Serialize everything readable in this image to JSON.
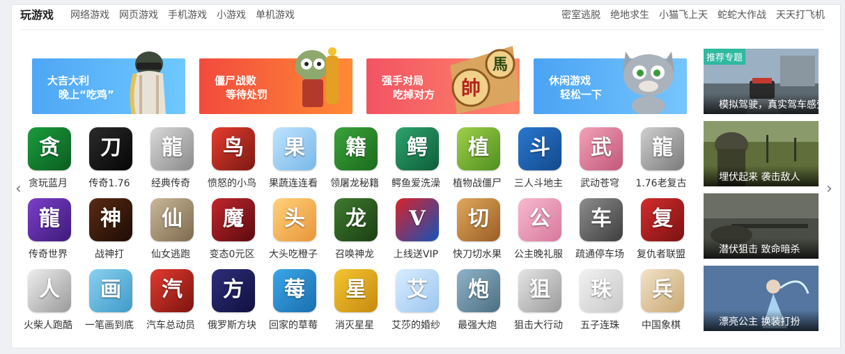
{
  "header": {
    "brand": "玩游戏",
    "nav_left": [
      "网络游戏",
      "网页游戏",
      "手机游戏",
      "小游戏",
      "单机游戏"
    ],
    "nav_right": [
      "密室逃脱",
      "绝地求生",
      "小猫飞上天",
      "蛇蛇大作战",
      "天天打飞机"
    ]
  },
  "banners": [
    {
      "line1": "大吉大利",
      "line2": "晚上“吃鸡”",
      "from": "#4fa6f5",
      "to": "#6ec9ff"
    },
    {
      "line1": "僵尸战败",
      "line2": "等待处罚",
      "from": "#f24a3e",
      "to": "#ff8a34"
    },
    {
      "line1": "强手对局",
      "line2": "吃掉对方",
      "from": "#f25363",
      "to": "#ff866a"
    },
    {
      "line1": "休闲游戏",
      "line2": "轻松一下",
      "from": "#4aa3f3",
      "to": "#75c5ff"
    }
  ],
  "games": [
    [
      {
        "name": "贪玩蓝月",
        "glyph": "贪",
        "c1": "#1a9b3c",
        "c2": "#0b5e20"
      },
      {
        "name": "传奇1.76",
        "glyph": "刀",
        "c1": "#2b2b2b",
        "c2": "#050505"
      },
      {
        "name": "经典传奇",
        "glyph": "龍",
        "c1": "#d9d9d9",
        "c2": "#8a8a8a"
      },
      {
        "name": "愤怒的小鸟",
        "glyph": "鸟",
        "c1": "#e63b2e",
        "c2": "#7a1a12"
      },
      {
        "name": "果蔬连连看",
        "glyph": "果",
        "c1": "#bfe3ff",
        "c2": "#79b8e8"
      },
      {
        "name": "领屠龙秘籍",
        "glyph": "籍",
        "c1": "#3aa33a",
        "c2": "#1c6b1c"
      },
      {
        "name": "鳄鱼爱洗澡",
        "glyph": "鳄",
        "c1": "#2fa36d",
        "c2": "#0d5e3a"
      },
      {
        "name": "植物战僵尸",
        "glyph": "植",
        "c1": "#9fd04a",
        "c2": "#4f8f1f"
      },
      {
        "name": "三人斗地主",
        "glyph": "斗",
        "c1": "#2a77d0",
        "c2": "#134a8c"
      },
      {
        "name": "武动苍穹",
        "glyph": "武",
        "c1": "#f1a2b7",
        "c2": "#c2577a"
      },
      {
        "name": "1.76老复古",
        "glyph": "龍",
        "c1": "#cfcfcf",
        "c2": "#7a7a7a"
      }
    ],
    [
      {
        "name": "传奇世界",
        "glyph": "龍",
        "c1": "#7b3fc9",
        "c2": "#3e1a7a"
      },
      {
        "name": "战神打",
        "glyph": "神",
        "c1": "#5a2a14",
        "c2": "#1e0c05"
      },
      {
        "name": "仙女逃跑",
        "glyph": "仙",
        "c1": "#c9b89a",
        "c2": "#7e6a4e"
      },
      {
        "name": "变态0元区",
        "glyph": "魔",
        "c1": "#c1272d",
        "c2": "#5b0a0e"
      },
      {
        "name": "大头吃橙子",
        "glyph": "头",
        "c1": "#ffd27a",
        "c2": "#e8953a"
      },
      {
        "name": "召唤神龙",
        "glyph": "龙",
        "c1": "#3f7a2f",
        "c2": "#1a3f12"
      },
      {
        "name": "上线送VIP",
        "glyph": "V",
        "c1": "#d8232a",
        "c2": "#1552b8"
      },
      {
        "name": "快刀切水果",
        "glyph": "切",
        "c1": "#e0a85c",
        "c2": "#9a5e25"
      },
      {
        "name": "公主晚礼服",
        "glyph": "公",
        "c1": "#f7b9cf",
        "c2": "#d8789c"
      },
      {
        "name": "疏通停车场",
        "glyph": "车",
        "c1": "#8d8d8d",
        "c2": "#3e3e3e"
      },
      {
        "name": "复仇者联盟",
        "glyph": "复",
        "c1": "#d22c2c",
        "c2": "#7d1212"
      }
    ],
    [
      {
        "name": "火柴人跑酷",
        "glyph": "人",
        "c1": "#eeeeee",
        "c2": "#9a9a9a"
      },
      {
        "name": "一笔画到底",
        "glyph": "画",
        "c1": "#8ad0f0",
        "c2": "#3f9bc8"
      },
      {
        "name": "汽车总动员",
        "glyph": "汽",
        "c1": "#e23a2f",
        "c2": "#7c1510"
      },
      {
        "name": "俄罗斯方块",
        "glyph": "方",
        "c1": "#2e2e7a",
        "c2": "#101040"
      },
      {
        "name": "回家的草莓",
        "glyph": "莓",
        "c1": "#3aa6e8",
        "c2": "#1a6fae"
      },
      {
        "name": "消灭星星",
        "glyph": "星",
        "c1": "#f4c430",
        "c2": "#c78a10"
      },
      {
        "name": "艾莎的婚纱",
        "glyph": "艾",
        "c1": "#d8ecff",
        "c2": "#9cc6ef"
      },
      {
        "name": "最强大炮",
        "glyph": "炮",
        "c1": "#8fb3c9",
        "c2": "#4e6f82"
      },
      {
        "name": "狙击大行动",
        "glyph": "狙",
        "c1": "#e5e5e5",
        "c2": "#9b9b9b"
      },
      {
        "name": "五子连珠",
        "glyph": "珠",
        "c1": "#f1f1f1",
        "c2": "#c9c9c9"
      },
      {
        "name": "中国象棋",
        "glyph": "兵",
        "c1": "#f2e2c6",
        "c2": "#c9a874"
      }
    ]
  ],
  "sidebar": {
    "tag": "推荐专题",
    "items": [
      {
        "caption": "模拟驾驶，真实驾车感受",
        "c1": "#7c8f9e",
        "c2": "#3b4650"
      },
      {
        "caption": "埋伏起来 袭击敌人",
        "c1": "#6e7f46",
        "c2": "#2f3a1c"
      },
      {
        "caption": "潜伏狙击 致命暗杀",
        "c1": "#5a5e55",
        "c2": "#2a2c27"
      },
      {
        "caption": "漂亮公主 换装打扮",
        "c1": "#6d8fb8",
        "c2": "#2f4a6e"
      }
    ]
  },
  "nav_arrows": {
    "left": "‹",
    "right": "›"
  }
}
